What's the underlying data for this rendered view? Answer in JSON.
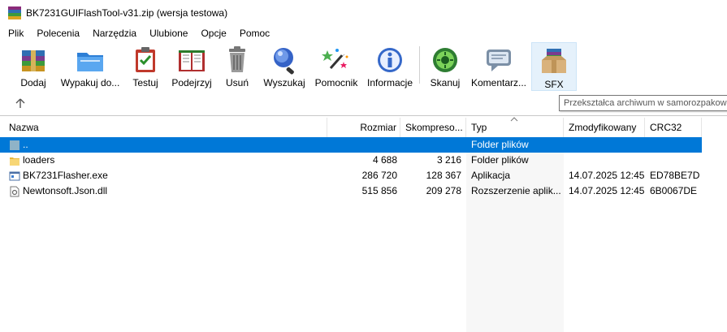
{
  "window": {
    "title": "BK7231GUIFlashTool-v31.zip (wersja testowa)"
  },
  "menu": [
    "Plik",
    "Polecenia",
    "Narzędzia",
    "Ulubione",
    "Opcje",
    "Pomoc"
  ],
  "toolbar": {
    "add": "Dodaj",
    "extract": "Wypakuj do...",
    "test": "Testuj",
    "view": "Podejrzyj",
    "delete": "Usuń",
    "find": "Wyszukaj",
    "wizard": "Pomocnik",
    "info": "Informacje",
    "scan": "Skanuj",
    "comment": "Komentarz...",
    "sfx": "SFX"
  },
  "tooltip": "Przekształca archiwum w samorozpakowujące",
  "columns": {
    "name": "Nazwa",
    "size": "Rozmiar",
    "packed": "Skompreso...",
    "type": "Typ",
    "modified": "Zmodyfikowany",
    "crc": "CRC32"
  },
  "rows": [
    {
      "name": "..",
      "size": "",
      "packed": "",
      "type": "Folder plików",
      "modified": "",
      "crc": "",
      "icon": "folder-up-icon"
    },
    {
      "name": "loaders",
      "size": "4 688",
      "packed": "3 216",
      "type": "Folder plików",
      "modified": "",
      "crc": "",
      "icon": "folder-icon"
    },
    {
      "name": "BK7231Flasher.exe",
      "size": "286 720",
      "packed": "128 367",
      "type": "Aplikacja",
      "modified": "14.07.2025 12:45",
      "crc": "ED78BE7D",
      "icon": "exe-icon"
    },
    {
      "name": "Newtonsoft.Json.dll",
      "size": "515 856",
      "packed": "209 278",
      "type": "Rozszerzenie aplik...",
      "modified": "14.07.2025 12:45",
      "crc": "6B0067DE",
      "icon": "dll-icon"
    }
  ],
  "colors": {
    "selection": "#0078d7",
    "accent_hover": "#e5f1fb"
  }
}
